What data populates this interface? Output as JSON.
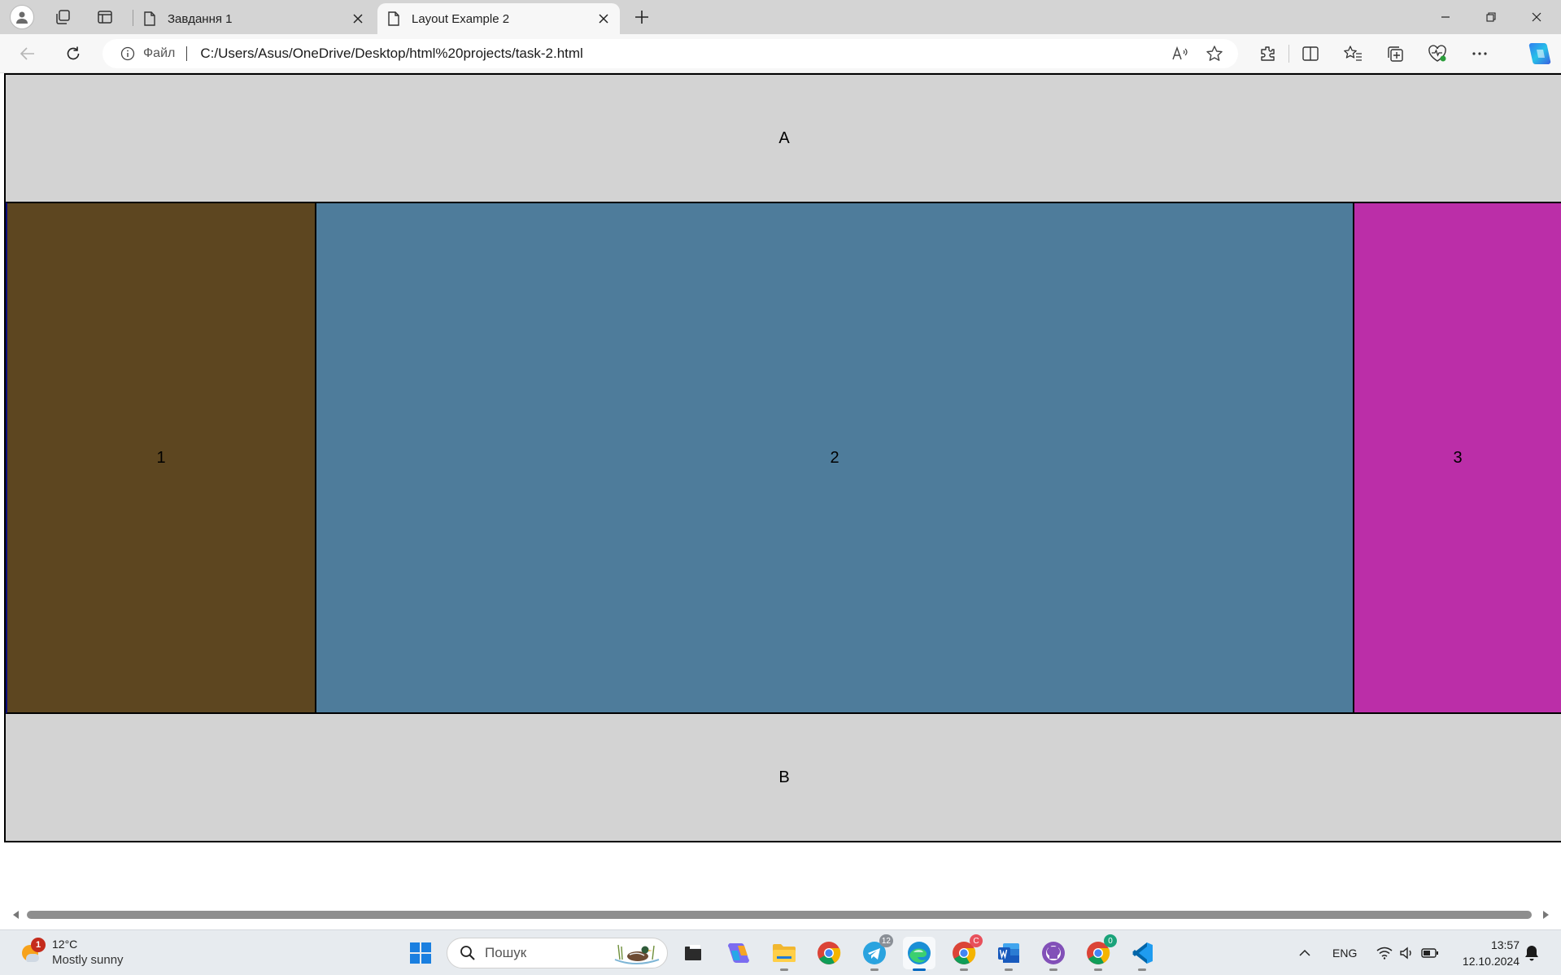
{
  "browser": {
    "tabs": [
      {
        "title": "Завдання 1",
        "active": false
      },
      {
        "title": "Layout Example 2",
        "active": true
      }
    ],
    "address_bar": {
      "site_label": "Файл",
      "url": "C:/Users/Asus/OneDrive/Desktop/html%20projects/task-2.html"
    }
  },
  "page": {
    "header": "A",
    "columns": [
      {
        "label": "1",
        "color": "#5d4620"
      },
      {
        "label": "2",
        "color": "#4e7c9b"
      },
      {
        "label": "3",
        "color": "#bb2ea8"
      }
    ],
    "footer": "B"
  },
  "taskbar": {
    "weather": {
      "temp": "12°C",
      "desc": "Mostly sunny",
      "badge": "1"
    },
    "search_placeholder": "Пошук",
    "apps": [
      {
        "name": "task-view",
        "badge": ""
      },
      {
        "name": "copilot",
        "badge": ""
      },
      {
        "name": "file-explorer",
        "badge": ""
      },
      {
        "name": "chrome",
        "badge": ""
      },
      {
        "name": "telegram",
        "badge": "12"
      },
      {
        "name": "edge",
        "badge": ""
      },
      {
        "name": "chrome-profile",
        "badge": "C"
      },
      {
        "name": "word",
        "badge": ""
      },
      {
        "name": "github-desktop",
        "badge": ""
      },
      {
        "name": "chrome-profile-2",
        "badge": "0"
      },
      {
        "name": "vscode",
        "badge": ""
      }
    ],
    "language": "ENG",
    "time": "13:57",
    "date": "12.10.2024"
  }
}
